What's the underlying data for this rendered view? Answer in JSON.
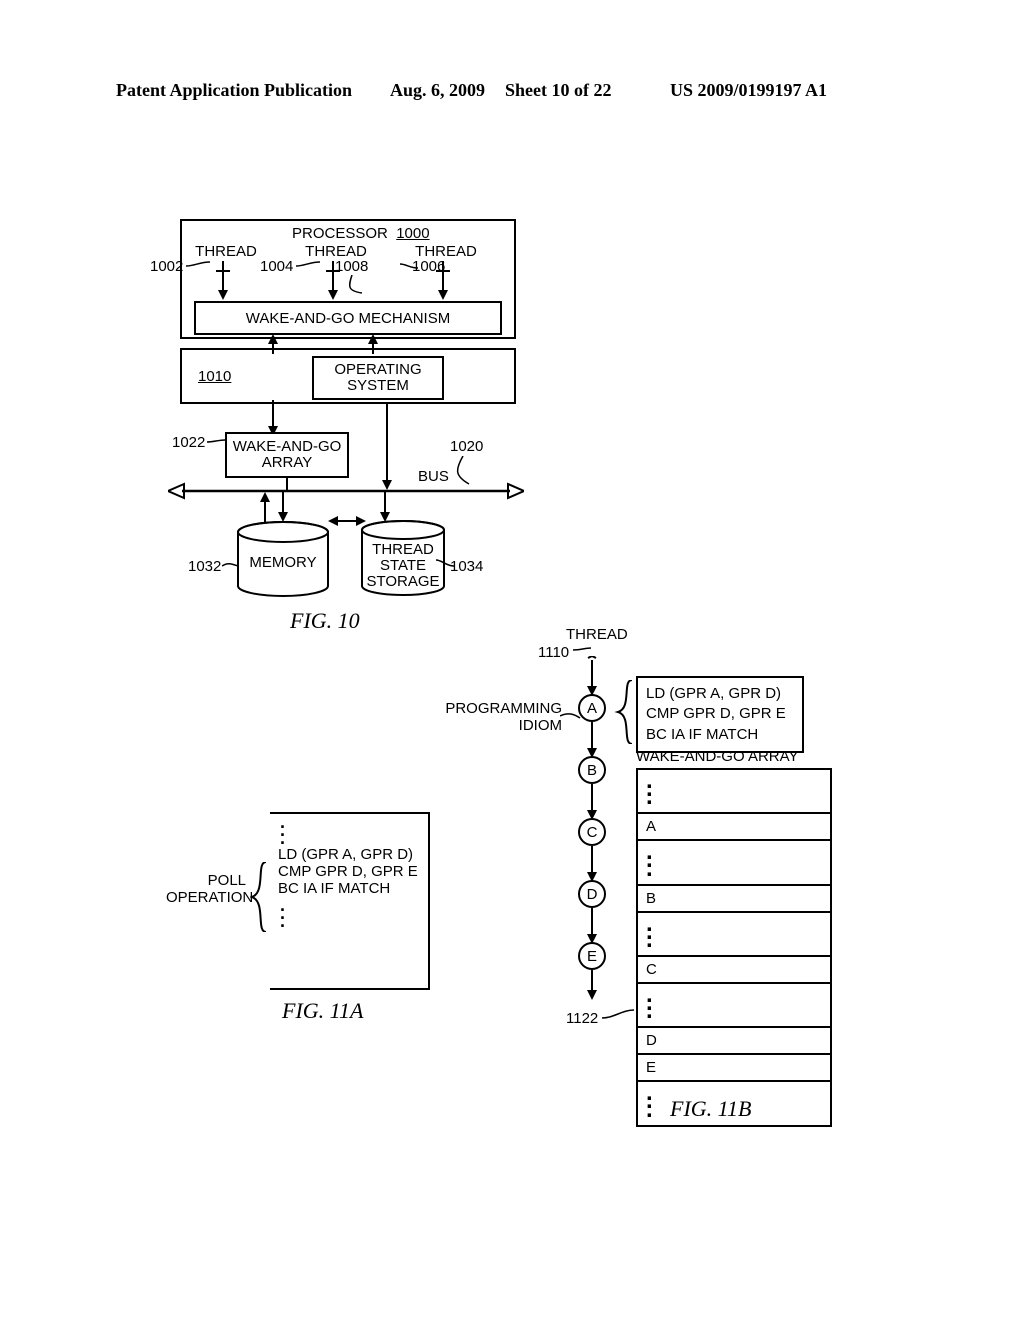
{
  "header": {
    "left": "Patent Application Publication",
    "date": "Aug. 6, 2009",
    "sheet": "Sheet 10 of 22",
    "right": "US 2009/0199197 A1"
  },
  "fig10": {
    "processor_label": "PROCESSOR",
    "processor_num": "1000",
    "thread_label": "THREAD",
    "ref_1002": "1002",
    "ref_1004": "1004",
    "ref_1006": "1006",
    "ref_1008": "1008",
    "wake_and_go_mech": "WAKE-AND-GO MECHANISM",
    "ref_1010": "1010",
    "os": "OPERATING\nSYSTEM",
    "ref_1022": "1022",
    "wake_and_go_array": "WAKE-AND-GO\nARRAY",
    "ref_1020": "1020",
    "bus": "BUS",
    "ref_1032": "1032",
    "memory": "MEMORY",
    "ref_1034": "1034",
    "thread_state_storage": "THREAD\nSTATE\nSTORAGE",
    "caption": "FIG. 10"
  },
  "fig11a": {
    "poll_label": "POLL\nOPERATION",
    "ld": "LD (GPR A, GPR D)",
    "cmp": "CMP GPR D, GPR E",
    "bc": "BC IA IF MATCH",
    "caption": "FIG. 11A"
  },
  "fig11b": {
    "thread_label": "THREAD",
    "ref_1110": "1110",
    "prog_idiom": "PROGRAMMING\nIDIOM",
    "ld": "LD (GPR A, GPR D)",
    "cmp": "CMP GPR D, GPR E",
    "bc": "BC IA IF MATCH",
    "nodes": {
      "a": "A",
      "b": "B",
      "c": "C",
      "d": "D",
      "e": "E"
    },
    "wag_title": "WAKE-AND-GO ARRAY",
    "rows": {
      "a": "A",
      "b": "B",
      "c": "C",
      "d": "D",
      "e": "E"
    },
    "ref_1122": "1122",
    "caption": "FIG. 11B"
  }
}
